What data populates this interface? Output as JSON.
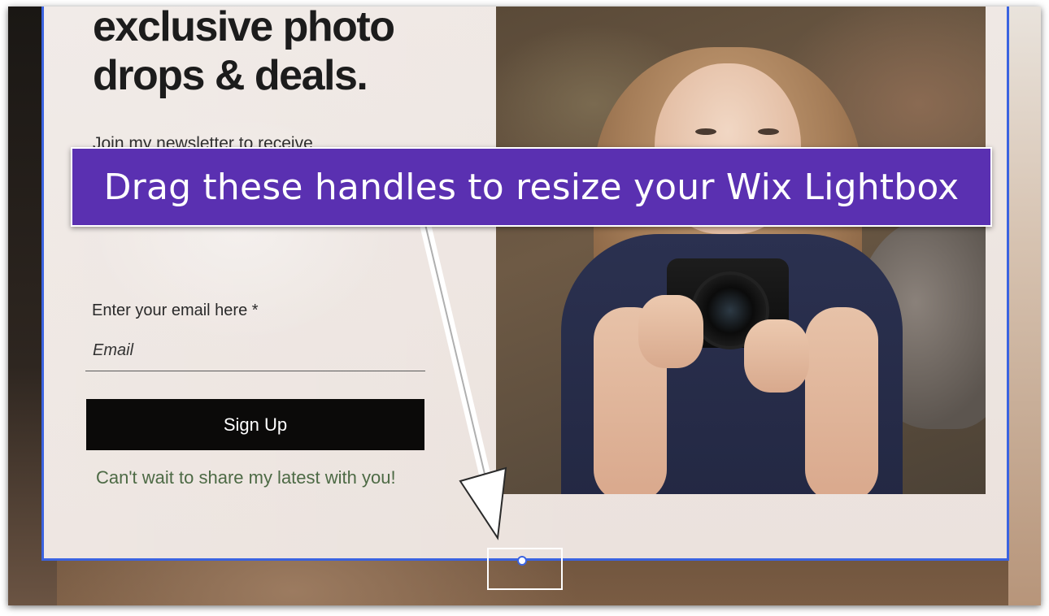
{
  "lightbox": {
    "headline_line1": "exclusive photo",
    "headline_line2": "drops & deals.",
    "subtext": "Join my newsletter to receive",
    "email_label": "Enter your email here *",
    "email_placeholder": "Email",
    "signup_label": "Sign Up",
    "tagline": "Can't wait to share my latest with you!"
  },
  "callout": {
    "text": "Drag these handles to resize your Wix Lightbox"
  },
  "colors": {
    "selection_border": "#3b63e0",
    "callout_bg": "#5a30b1",
    "tagline": "#4d6a45",
    "button_bg": "#0b0a09"
  }
}
